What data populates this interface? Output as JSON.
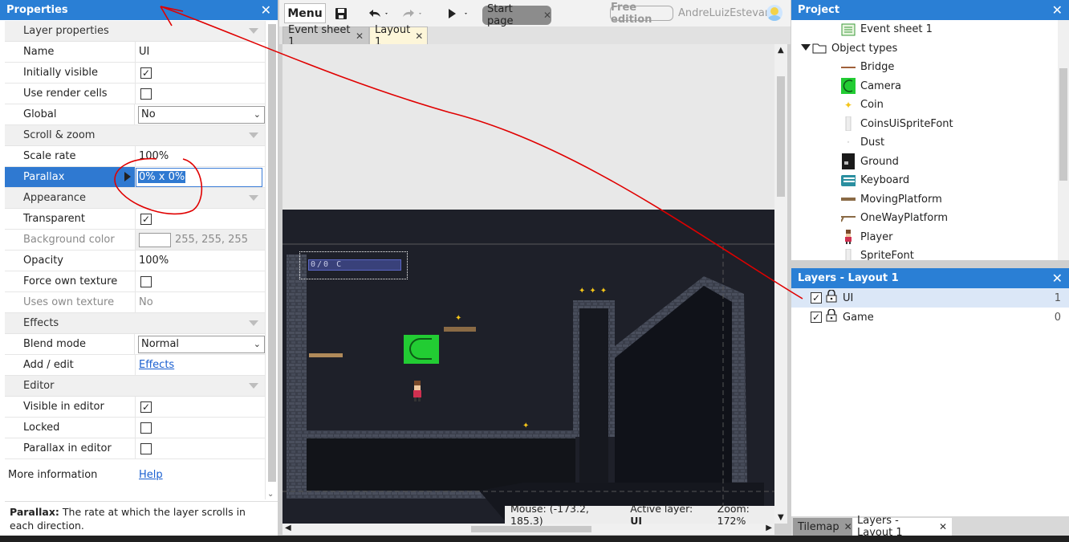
{
  "properties": {
    "title": "Properties",
    "rows": [
      {
        "type": "section",
        "label": "Layer properties"
      },
      {
        "type": "text",
        "label": "Name",
        "value": "UI"
      },
      {
        "type": "check",
        "label": "Initially visible",
        "checked": true
      },
      {
        "type": "check",
        "label": "Use render cells",
        "checked": false
      },
      {
        "type": "select",
        "label": "Global",
        "value": "No"
      },
      {
        "type": "section",
        "label": "Scroll & zoom"
      },
      {
        "type": "text",
        "label": "Scale rate",
        "value": "100%"
      },
      {
        "type": "highlight",
        "label": "Parallax",
        "value": "0% x 0%"
      },
      {
        "type": "section",
        "label": "Appearance"
      },
      {
        "type": "check",
        "label": "Transparent",
        "checked": true
      },
      {
        "type": "color",
        "label": "Background color",
        "value": "255, 255, 255",
        "dim": true
      },
      {
        "type": "text",
        "label": "Opacity",
        "value": "100%"
      },
      {
        "type": "check",
        "label": "Force own texture",
        "checked": false
      },
      {
        "type": "text",
        "label": "Uses own texture",
        "value": "No",
        "dim": true
      },
      {
        "type": "section",
        "label": "Effects"
      },
      {
        "type": "select",
        "label": "Blend mode",
        "value": "Normal"
      },
      {
        "type": "link",
        "label": "Add / edit",
        "value": "Effects"
      },
      {
        "type": "section",
        "label": "Editor"
      },
      {
        "type": "check",
        "label": "Visible in editor",
        "checked": true
      },
      {
        "type": "check",
        "label": "Locked",
        "checked": false
      },
      {
        "type": "check",
        "label": "Parallax in editor",
        "checked": false
      }
    ],
    "more_info_label": "More information",
    "more_info_link": "Help",
    "desc_bold": "Parallax:",
    "desc_text": " The rate at which the layer scrolls in each direction."
  },
  "toolbar": {
    "menu_label": "Menu",
    "start_tab": "Start page",
    "edition": "Free edition",
    "user": "AndreLuizEstevam"
  },
  "doc_tabs": [
    "Event sheet 1",
    "Layout 1"
  ],
  "status": {
    "mouse": "Mouse: (-173.2, 185.3)",
    "active_layer_label": "Active layer:",
    "active_layer": "UI",
    "zoom": "Zoom: 172%"
  },
  "project": {
    "title": "Project",
    "items": [
      {
        "label": "Event sheet 1",
        "icon": "event-sheet-icon",
        "indent": 62
      },
      {
        "label": "Object types",
        "icon": "folder-icon",
        "indent": 26,
        "expander": true
      },
      {
        "label": "Bridge",
        "icon": "bridge-icon",
        "indent": 62
      },
      {
        "label": "Camera",
        "icon": "camera-icon",
        "indent": 62
      },
      {
        "label": "Coin",
        "icon": "coin-icon",
        "indent": 62
      },
      {
        "label": "CoinsUiSpriteFont",
        "icon": "spritefont-icon",
        "indent": 62
      },
      {
        "label": "Dust",
        "icon": "dust-icon",
        "indent": 62
      },
      {
        "label": "Ground",
        "icon": "ground-icon",
        "indent": 62
      },
      {
        "label": "Keyboard",
        "icon": "keyboard-icon",
        "indent": 62
      },
      {
        "label": "MovingPlatform",
        "icon": "moving-platform-icon",
        "indent": 62
      },
      {
        "label": "OneWayPlatform",
        "icon": "oneway-platform-icon",
        "indent": 62
      },
      {
        "label": "Player",
        "icon": "player-icon",
        "indent": 62
      },
      {
        "label": "SpriteFont",
        "icon": "spritefont-icon",
        "indent": 62
      }
    ]
  },
  "layers": {
    "title": "Layers - Layout 1",
    "items": [
      {
        "name": "UI",
        "index": "1"
      },
      {
        "name": "Game",
        "index": "0"
      }
    ]
  },
  "bottom_tabs": [
    "Tilemap",
    "Layers - Layout 1"
  ],
  "game_hud_text": "0/0 C",
  "colors": {
    "accent": "#2a7fd5",
    "annotation": "#e00000",
    "camera": "#22cc33"
  }
}
